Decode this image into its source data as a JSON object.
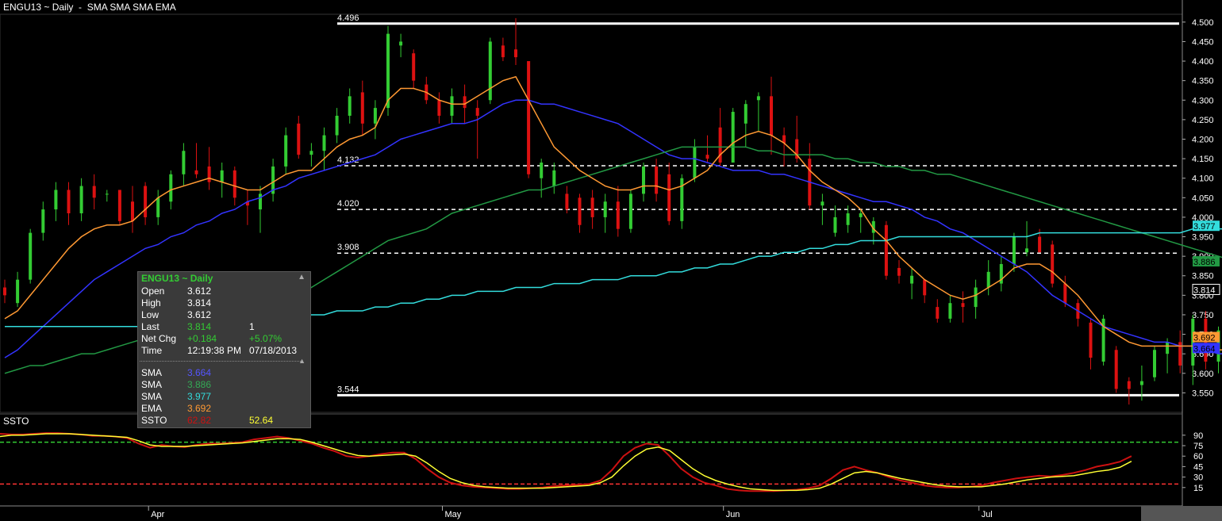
{
  "header": {
    "symbol_title": "ENGU13 ~ Daily",
    "separator": "-",
    "studies_label": "SMA SMA SMA EMA"
  },
  "lower_panel": {
    "title": "SSTO",
    "ticks": [
      15,
      30,
      45,
      60,
      75,
      90
    ],
    "upper_level": 80,
    "lower_level": 20,
    "colors": {
      "fast": "#cc1111",
      "slow": "#ffff33",
      "upper": "#33cc33",
      "lower": "#ff3333"
    }
  },
  "tooltip": {
    "header": "ENGU13 ~ Daily",
    "rows": [
      {
        "label": "Open",
        "value": "3.612"
      },
      {
        "label": "High",
        "value": "3.814"
      },
      {
        "label": "Low",
        "value": "3.612"
      },
      {
        "label": "Last",
        "value": "3.814",
        "value2": "1"
      },
      {
        "label": "Net Chg",
        "value": "+0.184",
        "value2": "+5.07%"
      },
      {
        "label": "Time",
        "value": "12:19:38 PM",
        "value2": "07/18/2013"
      }
    ],
    "study_rows": [
      {
        "label": "SMA",
        "value": "3.664",
        "color": "#5555ff"
      },
      {
        "label": "SMA",
        "value": "3.886",
        "color": "#33aa55"
      },
      {
        "label": "SMA",
        "value": "3.977",
        "color": "#33dddd"
      },
      {
        "label": "EMA",
        "value": "3.692",
        "color": "#ff9933"
      },
      {
        "label": "SSTO",
        "value": "62.82",
        "value2": "52.64",
        "color": "#cc1111",
        "color2": "#ffff33"
      }
    ]
  },
  "chart_data": {
    "type": "candlestick",
    "title": "ENGU13 ~ Daily",
    "ylim": [
      3.5,
      4.52
    ],
    "y_ticks": [
      3.55,
      3.6,
      3.65,
      3.7,
      3.75,
      3.8,
      3.85,
      3.9,
      3.95,
      4.0,
      4.05,
      4.1,
      4.15,
      4.2,
      4.25,
      4.3,
      4.35,
      4.4,
      4.45,
      4.5
    ],
    "x_month_labels": [
      {
        "label": "Apr",
        "index": 12
      },
      {
        "label": "May",
        "index": 35
      },
      {
        "label": "Jun",
        "index": 57
      },
      {
        "label": "Jul",
        "index": 77
      }
    ],
    "colors": {
      "up": "#33cc33",
      "down": "#dd1111",
      "sma1": "#3333ff",
      "sma2": "#229944",
      "sma3": "#33dddd",
      "ema": "#ff9933"
    },
    "horizontal_levels": [
      {
        "value": 4.496,
        "label": "4.496",
        "style": "solid"
      },
      {
        "value": 4.132,
        "label": "4.132",
        "style": "dashed"
      },
      {
        "value": 4.02,
        "label": "4.020",
        "style": "dashed"
      },
      {
        "value": 3.908,
        "label": "3.908",
        "style": "dashed"
      },
      {
        "value": 3.544,
        "label": "3.544",
        "style": "solid"
      }
    ],
    "price_tags": [
      {
        "label": "3.977",
        "value": 3.977,
        "color": "#33dddd"
      },
      {
        "label": "3.886",
        "value": 3.886,
        "color": "#229944"
      },
      {
        "label": "3.814",
        "value": 3.814,
        "color": "#ffffff"
      },
      {
        "label": "3.692",
        "value": 3.692,
        "color": "#ff9933"
      },
      {
        "label": "3.664",
        "value": 3.664,
        "color": "#3333ff"
      }
    ],
    "candles": [
      [
        3.82,
        3.84,
        3.78,
        3.8
      ],
      [
        3.78,
        3.86,
        3.77,
        3.84
      ],
      [
        3.84,
        3.97,
        3.83,
        3.96
      ],
      [
        3.96,
        4.04,
        3.94,
        4.02
      ],
      [
        4.02,
        4.09,
        3.99,
        4.07
      ],
      [
        4.07,
        4.09,
        3.98,
        4.01
      ],
      [
        4.01,
        4.1,
        3.99,
        4.08
      ],
      [
        4.08,
        4.11,
        4.02,
        4.05
      ],
      [
        4.06,
        4.07,
        4.04,
        4.06
      ],
      [
        4.07,
        4.07,
        3.98,
        3.99
      ],
      [
        4.04,
        4.08,
        3.96,
        3.99
      ],
      [
        4.08,
        4.09,
        3.98,
        4.0
      ],
      [
        4.0,
        4.07,
        3.98,
        4.05
      ],
      [
        4.04,
        4.12,
        4.02,
        4.11
      ],
      [
        4.11,
        4.19,
        4.08,
        4.17
      ],
      [
        4.12,
        4.19,
        4.1,
        4.11
      ],
      [
        4.13,
        4.18,
        4.07,
        4.09
      ],
      [
        4.09,
        4.14,
        4.05,
        4.12
      ],
      [
        4.12,
        4.13,
        4.03,
        4.05
      ],
      [
        4.04,
        4.07,
        3.98,
        4.03
      ],
      [
        4.02,
        4.08,
        3.96,
        4.06
      ],
      [
        4.06,
        4.15,
        4.04,
        4.13
      ],
      [
        4.13,
        4.23,
        4.11,
        4.21
      ],
      [
        4.24,
        4.26,
        4.15,
        4.16
      ],
      [
        4.16,
        4.19,
        4.13,
        4.17
      ],
      [
        4.17,
        4.23,
        4.12,
        4.21
      ],
      [
        4.21,
        4.28,
        4.19,
        4.26
      ],
      [
        4.26,
        4.33,
        4.24,
        4.31
      ],
      [
        4.32,
        4.35,
        4.21,
        4.24
      ],
      [
        4.24,
        4.3,
        4.2,
        4.28
      ],
      [
        4.28,
        4.49,
        4.26,
        4.47
      ],
      [
        4.44,
        4.47,
        4.41,
        4.45
      ],
      [
        4.42,
        4.43,
        4.33,
        4.35
      ],
      [
        4.34,
        4.36,
        4.29,
        4.3
      ],
      [
        4.3,
        4.32,
        4.24,
        4.26
      ],
      [
        4.26,
        4.33,
        4.24,
        4.31
      ],
      [
        4.31,
        4.34,
        4.24,
        4.28
      ],
      [
        4.28,
        4.3,
        4.15,
        4.26
      ],
      [
        4.3,
        4.46,
        4.29,
        4.45
      ],
      [
        4.44,
        4.46,
        4.4,
        4.41
      ],
      [
        4.43,
        4.51,
        4.39,
        4.41
      ],
      [
        4.4,
        4.39,
        4.1,
        4.11
      ],
      [
        4.1,
        4.15,
        4.05,
        4.14
      ],
      [
        4.08,
        4.14,
        4.06,
        4.12
      ],
      [
        4.06,
        4.08,
        4.01,
        4.02
      ],
      [
        4.05,
        4.06,
        3.96,
        3.98
      ],
      [
        4.05,
        4.07,
        3.97,
        4.0
      ],
      [
        4.0,
        4.06,
        3.96,
        4.04
      ],
      [
        4.04,
        4.08,
        3.95,
        3.97
      ],
      [
        3.97,
        4.07,
        3.96,
        4.06
      ],
      [
        4.06,
        4.14,
        4.04,
        4.13
      ],
      [
        4.13,
        4.15,
        4.04,
        4.06
      ],
      [
        4.11,
        4.14,
        3.98,
        3.99
      ],
      [
        3.99,
        4.11,
        3.97,
        4.1
      ],
      [
        4.1,
        4.2,
        4.09,
        4.18
      ],
      [
        4.16,
        4.21,
        4.14,
        4.15
      ],
      [
        4.23,
        4.28,
        4.13,
        4.14
      ],
      [
        4.14,
        4.28,
        4.14,
        4.27
      ],
      [
        4.24,
        4.3,
        4.18,
        4.29
      ],
      [
        4.3,
        4.32,
        4.22,
        4.31
      ],
      [
        4.31,
        4.36,
        4.16,
        4.21
      ],
      [
        4.21,
        4.23,
        4.13,
        4.19
      ],
      [
        4.2,
        4.26,
        4.14,
        4.15
      ],
      [
        4.15,
        4.19,
        4.02,
        4.03
      ],
      [
        4.03,
        4.06,
        3.98,
        4.04
      ],
      [
        3.96,
        4.03,
        3.95,
        4.0
      ],
      [
        3.98,
        4.03,
        3.96,
        4.01
      ],
      [
        4.0,
        4.02,
        3.96,
        4.01
      ],
      [
        3.96,
        4.0,
        3.93,
        3.99
      ],
      [
        3.98,
        3.99,
        3.84,
        3.85
      ],
      [
        3.87,
        3.89,
        3.83,
        3.85
      ],
      [
        3.83,
        3.87,
        3.79,
        3.85
      ],
      [
        3.84,
        3.84,
        3.78,
        3.8
      ],
      [
        3.77,
        3.79,
        3.73,
        3.74
      ],
      [
        3.74,
        3.8,
        3.73,
        3.78
      ],
      [
        3.78,
        3.81,
        3.73,
        3.77
      ],
      [
        3.77,
        3.84,
        3.74,
        3.82
      ],
      [
        3.82,
        3.89,
        3.8,
        3.86
      ],
      [
        3.83,
        3.9,
        3.81,
        3.88
      ],
      [
        3.88,
        3.96,
        3.86,
        3.95
      ],
      [
        3.91,
        3.99,
        3.9,
        3.92
      ],
      [
        3.95,
        3.97,
        3.91,
        3.91
      ],
      [
        3.93,
        3.94,
        3.82,
        3.83
      ],
      [
        3.83,
        3.85,
        3.77,
        3.78
      ],
      [
        3.78,
        3.79,
        3.72,
        3.74
      ],
      [
        3.73,
        3.74,
        3.61,
        3.64
      ],
      [
        3.63,
        3.75,
        3.62,
        3.74
      ],
      [
        3.66,
        3.67,
        3.55,
        3.56
      ],
      [
        3.58,
        3.59,
        3.52,
        3.56
      ],
      [
        3.57,
        3.62,
        3.53,
        3.58
      ],
      [
        3.59,
        3.67,
        3.58,
        3.66
      ],
      [
        3.65,
        3.69,
        3.6,
        3.68
      ],
      [
        3.68,
        3.71,
        3.6,
        3.62
      ],
      [
        3.62,
        3.75,
        3.57,
        3.74
      ],
      [
        3.74,
        3.76,
        3.61,
        3.63
      ],
      [
        3.63,
        3.72,
        3.6,
        3.71
      ],
      [
        3.71,
        3.79,
        3.62,
        3.63
      ],
      [
        3.65,
        3.7,
        3.58,
        3.66
      ],
      [
        3.66,
        3.69,
        3.55,
        3.68
      ],
      [
        3.67,
        3.67,
        3.62,
        3.63
      ],
      [
        3.66,
        3.68,
        3.61,
        3.62
      ],
      [
        3.61,
        3.81,
        3.6,
        3.81
      ]
    ],
    "series": [
      {
        "name": "SMA",
        "color": "#3333ff",
        "values": [
          3.64,
          3.66,
          3.69,
          3.72,
          3.75,
          3.78,
          3.81,
          3.84,
          3.86,
          3.88,
          3.9,
          3.92,
          3.93,
          3.95,
          3.96,
          3.98,
          3.99,
          4.01,
          4.02,
          4.04,
          4.05,
          4.07,
          4.08,
          4.1,
          4.11,
          4.12,
          4.13,
          4.14,
          4.15,
          4.16,
          4.18,
          4.2,
          4.21,
          4.22,
          4.23,
          4.24,
          4.24,
          4.25,
          4.27,
          4.29,
          4.3,
          4.3,
          4.29,
          4.29,
          4.28,
          4.27,
          4.26,
          4.25,
          4.24,
          4.22,
          4.2,
          4.18,
          4.16,
          4.15,
          4.15,
          4.14,
          4.13,
          4.12,
          4.12,
          4.12,
          4.11,
          4.11,
          4.1,
          4.09,
          4.08,
          4.07,
          4.06,
          4.05,
          4.04,
          4.04,
          4.03,
          4.02,
          4.0,
          3.99,
          3.97,
          3.96,
          3.94,
          3.92,
          3.9,
          3.88,
          3.86,
          3.83,
          3.8,
          3.78,
          3.76,
          3.74,
          3.72,
          3.71,
          3.7,
          3.69,
          3.68,
          3.68,
          3.67,
          3.67,
          3.66,
          3.65,
          3.65,
          3.66,
          3.66,
          3.66,
          3.664
        ]
      },
      {
        "name": "SMA",
        "color": "#229944",
        "values": [
          3.6,
          3.61,
          3.62,
          3.62,
          3.63,
          3.64,
          3.65,
          3.65,
          3.66,
          3.67,
          3.68,
          3.69,
          3.7,
          3.71,
          3.71,
          3.72,
          3.73,
          3.74,
          3.75,
          3.76,
          3.77,
          3.78,
          3.79,
          3.8,
          3.82,
          3.84,
          3.86,
          3.88,
          3.9,
          3.92,
          3.94,
          3.95,
          3.96,
          3.97,
          3.99,
          4.01,
          4.02,
          4.03,
          4.04,
          4.05,
          4.06,
          4.07,
          4.07,
          4.08,
          4.09,
          4.1,
          4.11,
          4.12,
          4.13,
          4.14,
          4.15,
          4.16,
          4.17,
          4.18,
          4.18,
          4.18,
          4.18,
          4.18,
          4.18,
          4.17,
          4.17,
          4.16,
          4.16,
          4.16,
          4.16,
          4.15,
          4.15,
          4.14,
          4.14,
          4.13,
          4.13,
          4.12,
          4.12,
          4.11,
          4.11,
          4.1,
          4.09,
          4.08,
          4.07,
          4.06,
          4.05,
          4.04,
          4.03,
          4.02,
          4.01,
          4.0,
          3.99,
          3.98,
          3.97,
          3.96,
          3.95,
          3.94,
          3.93,
          3.92,
          3.91,
          3.9,
          3.89,
          3.89,
          3.886
        ]
      },
      {
        "name": "SMA",
        "color": "#33dddd",
        "values": [
          3.72,
          3.72,
          3.72,
          3.72,
          3.72,
          3.72,
          3.72,
          3.72,
          3.72,
          3.72,
          3.72,
          3.72,
          3.72,
          3.73,
          3.73,
          3.73,
          3.73,
          3.73,
          3.73,
          3.74,
          3.74,
          3.74,
          3.74,
          3.75,
          3.75,
          3.75,
          3.76,
          3.76,
          3.76,
          3.77,
          3.77,
          3.78,
          3.78,
          3.79,
          3.79,
          3.8,
          3.8,
          3.81,
          3.81,
          3.81,
          3.82,
          3.82,
          3.82,
          3.83,
          3.83,
          3.83,
          3.84,
          3.84,
          3.84,
          3.85,
          3.85,
          3.85,
          3.86,
          3.86,
          3.87,
          3.87,
          3.88,
          3.88,
          3.89,
          3.9,
          3.9,
          3.91,
          3.91,
          3.92,
          3.92,
          3.93,
          3.93,
          3.94,
          3.94,
          3.94,
          3.95,
          3.95,
          3.95,
          3.95,
          3.95,
          3.95,
          3.95,
          3.95,
          3.95,
          3.95,
          3.95,
          3.96,
          3.96,
          3.96,
          3.96,
          3.96,
          3.96,
          3.96,
          3.96,
          3.96,
          3.96,
          3.96,
          3.96,
          3.97,
          3.97,
          3.97,
          3.97,
          3.97,
          3.977
        ]
      },
      {
        "name": "EMA",
        "color": "#ff9933",
        "values": [
          3.74,
          3.76,
          3.8,
          3.84,
          3.88,
          3.92,
          3.95,
          3.97,
          3.98,
          3.98,
          3.99,
          4.02,
          4.05,
          4.07,
          4.08,
          4.09,
          4.1,
          4.09,
          4.08,
          4.07,
          4.07,
          4.09,
          4.11,
          4.12,
          4.12,
          4.15,
          4.18,
          4.2,
          4.21,
          4.23,
          4.3,
          4.33,
          4.33,
          4.32,
          4.3,
          4.29,
          4.29,
          4.31,
          4.33,
          4.35,
          4.36,
          4.3,
          4.24,
          4.18,
          4.15,
          4.12,
          4.1,
          4.08,
          4.07,
          4.07,
          4.08,
          4.08,
          4.07,
          4.08,
          4.1,
          4.12,
          4.16,
          4.19,
          4.21,
          4.22,
          4.21,
          4.19,
          4.16,
          4.12,
          4.09,
          4.07,
          4.05,
          4.02,
          3.97,
          3.94,
          3.9,
          3.87,
          3.84,
          3.82,
          3.8,
          3.79,
          3.8,
          3.82,
          3.84,
          3.87,
          3.88,
          3.88,
          3.86,
          3.83,
          3.8,
          3.76,
          3.72,
          3.7,
          3.68,
          3.67,
          3.67,
          3.67,
          3.67,
          3.67,
          3.66,
          3.66,
          3.66,
          3.66,
          3.66,
          3.65,
          3.692
        ]
      }
    ],
    "ssto": {
      "fast": [
        92,
        91,
        91,
        92,
        93,
        93,
        92,
        91,
        89,
        89,
        88,
        86,
        78,
        72,
        76,
        74,
        73,
        76,
        78,
        78,
        79,
        80,
        84,
        86,
        88,
        86,
        82,
        78,
        72,
        67,
        60,
        58,
        60,
        63,
        65,
        65,
        56,
        42,
        30,
        22,
        18,
        16,
        15,
        14,
        13,
        13,
        14,
        15,
        17,
        18,
        19,
        20,
        25,
        40,
        60,
        72,
        78,
        76,
        60,
        42,
        30,
        22,
        18,
        13,
        11,
        10,
        10,
        10,
        11,
        12,
        14,
        18,
        28,
        40,
        45,
        40,
        36,
        30,
        25,
        22,
        18,
        16,
        15,
        15,
        16,
        18,
        22,
        25,
        28,
        30,
        32,
        31,
        33,
        36,
        40,
        45,
        48,
        52,
        60
      ],
      "slow": [
        88,
        90,
        90,
        91,
        92,
        92,
        92,
        91,
        90,
        89,
        88,
        87,
        82,
        76,
        74,
        74,
        74,
        75,
        76,
        77,
        78,
        79,
        81,
        83,
        85,
        85,
        84,
        80,
        75,
        70,
        65,
        61,
        60,
        61,
        62,
        63,
        60,
        50,
        38,
        28,
        22,
        18,
        16,
        15,
        14,
        14,
        14,
        14,
        15,
        16,
        17,
        18,
        22,
        30,
        46,
        60,
        70,
        73,
        68,
        55,
        42,
        32,
        25,
        20,
        16,
        13,
        12,
        11,
        11,
        11,
        12,
        14,
        20,
        28,
        36,
        38,
        36,
        32,
        28,
        25,
        22,
        19,
        17,
        16,
        16,
        16,
        18,
        20,
        23,
        26,
        28,
        30,
        31,
        32,
        35,
        38,
        40,
        44,
        52.64
      ]
    }
  }
}
